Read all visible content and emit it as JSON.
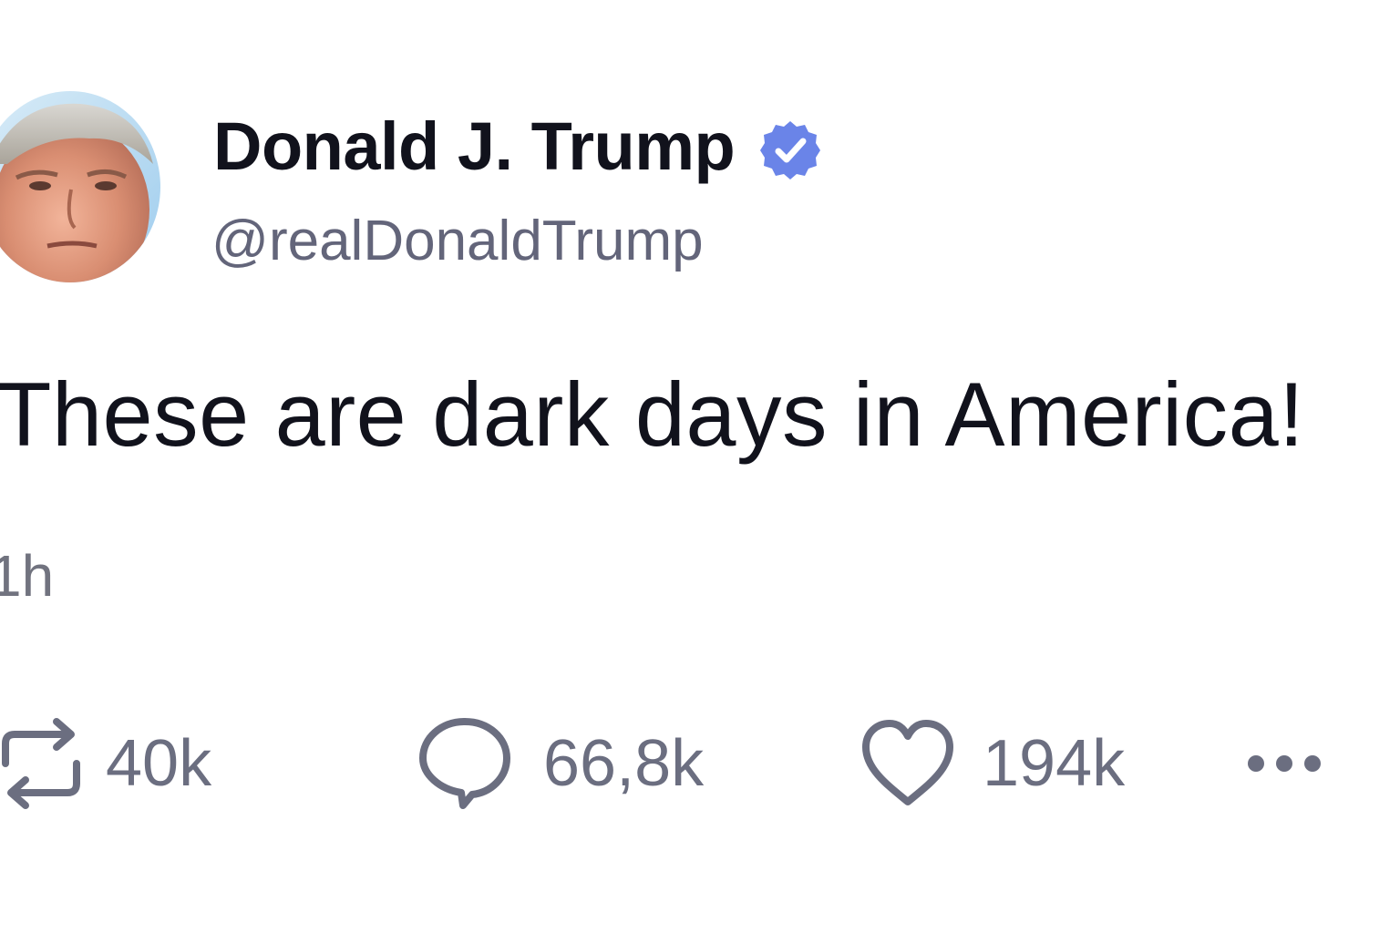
{
  "post": {
    "author": {
      "display_name": "Donald J. Trump",
      "handle": "@realDonaldTrump",
      "verified": true
    },
    "text": "These are dark days in America!",
    "timestamp": "1h",
    "stats": {
      "retweets": "40k",
      "replies": "66,8k",
      "likes": "194k"
    }
  },
  "icons": {
    "retweet": "retweet-icon",
    "reply": "reply-icon",
    "like": "heart-icon",
    "more": "more-icon",
    "verified": "verified-badge-icon"
  },
  "colors": {
    "text_primary": "#11121c",
    "text_secondary": "#63657a",
    "icon_gray": "#6b6e80",
    "verified_blue": "#6a84e8"
  }
}
